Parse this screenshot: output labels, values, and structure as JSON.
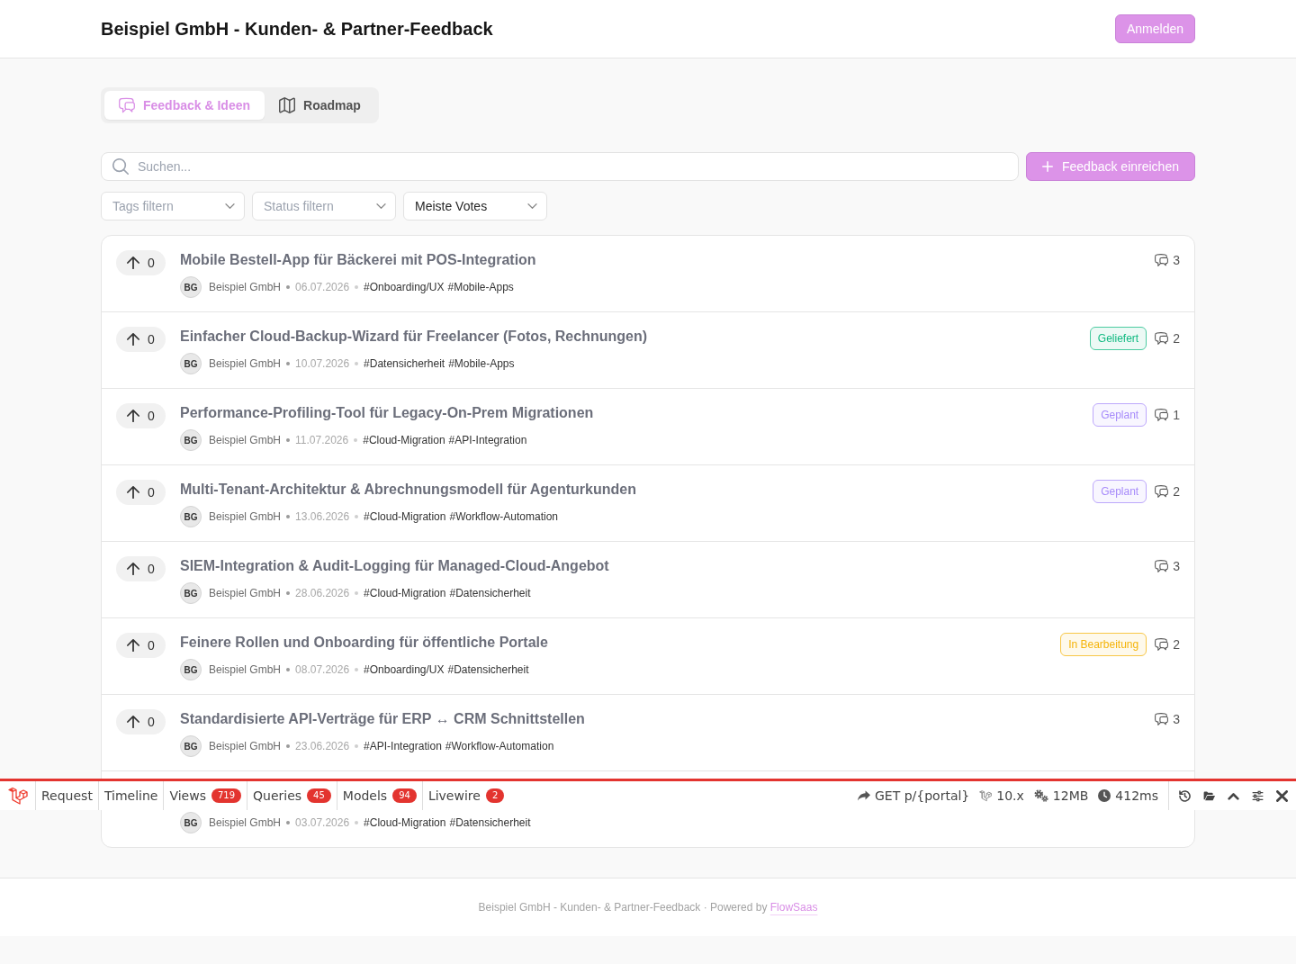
{
  "header": {
    "title": "Beispiel GmbH - Kunden- & Partner-Feedback",
    "login_button": "Anmelden"
  },
  "tabs": [
    {
      "label": "Feedback & Ideen",
      "selected": true
    },
    {
      "label": "Roadmap",
      "selected": false
    }
  ],
  "search": {
    "placeholder": "Suchen..."
  },
  "submit_button": "Feedback einreichen",
  "filters": [
    {
      "placeholder": "Tags filtern"
    },
    {
      "placeholder": "Status filtern"
    },
    {
      "value": "Meiste Votes"
    }
  ],
  "feedback_items": [
    {
      "votes": "0",
      "title": "Mobile Bestell-App für Bäckerei mit POS-Integration",
      "avatar": "BG",
      "author": "Beispiel GmbH",
      "date": "06.07.2026",
      "tags": [
        "#Onboarding/UX",
        "#Mobile-Apps"
      ],
      "comments": "3"
    },
    {
      "votes": "0",
      "title": "Einfacher Cloud-Backup-Wizard für Freelancer (Fotos, Rechnungen)",
      "avatar": "BG",
      "author": "Beispiel GmbH",
      "date": "10.07.2026",
      "tags": [
        "#Datensicherheit",
        "#Mobile-Apps"
      ],
      "status": {
        "label": "Geliefert",
        "color": "#10b981"
      },
      "comments": "2"
    },
    {
      "votes": "0",
      "title": "Performance-Profiling-Tool für Legacy-On-Prem Migrationen",
      "avatar": "BG",
      "author": "Beispiel GmbH",
      "date": "11.07.2026",
      "tags": [
        "#Cloud-Migration",
        "#API-Integration"
      ],
      "status": {
        "label": "Geplant",
        "color": "#a78bfa"
      },
      "comments": "1"
    },
    {
      "votes": "0",
      "title": "Multi-Tenant-Architektur & Abrechnungsmodell für Agenturkunden",
      "avatar": "BG",
      "author": "Beispiel GmbH",
      "date": "13.06.2026",
      "tags": [
        "#Cloud-Migration",
        "#Workflow-Automation"
      ],
      "status": {
        "label": "Geplant",
        "color": "#a78bfa"
      },
      "comments": "2"
    },
    {
      "votes": "0",
      "title": "SIEM-Integration & Audit-Logging für Managed-Cloud-Angebot",
      "avatar": "BG",
      "author": "Beispiel GmbH",
      "date": "28.06.2026",
      "tags": [
        "#Cloud-Migration",
        "#Datensicherheit"
      ],
      "comments": "3"
    },
    {
      "votes": "0",
      "title": "Feinere Rollen und Onboarding für öffentliche Portale",
      "avatar": "BG",
      "author": "Beispiel GmbH",
      "date": "08.07.2026",
      "tags": [
        "#Onboarding/UX",
        "#Datensicherheit"
      ],
      "status": {
        "label": "In Bearbeitung",
        "color": "#f5b40a"
      },
      "comments": "2"
    },
    {
      "votes": "0",
      "title": "Standardisierte API-Verträge für ERP ↔ CRM Schnittstellen",
      "avatar": "BG",
      "author": "Beispiel GmbH",
      "date": "23.06.2026",
      "tags": [
        "#API-Integration",
        "#Workflow-Automation"
      ],
      "comments": "3"
    },
    {
      "avatar": "BG",
      "author": "Beispiel GmbH",
      "date": "03.07.2026",
      "tags": [
        "#Cloud-Migration",
        "#Datensicherheit"
      ]
    }
  ],
  "footer": {
    "text": "Beispiel GmbH - Kunden- & Partner-Feedback · Powered by",
    "link": "FlowSaas"
  },
  "debug_bar": {
    "tabs": [
      {
        "label": "Request"
      },
      {
        "label": "Timeline"
      },
      {
        "label": "Views",
        "count": "719"
      },
      {
        "label": "Queries",
        "count": "45"
      },
      {
        "label": "Models",
        "count": "94"
      },
      {
        "label": "Livewire",
        "count": "2"
      }
    ],
    "info": [
      {
        "kind": "route",
        "text": "GET p/{portal}"
      },
      {
        "kind": "version",
        "text": "10.x"
      },
      {
        "kind": "memory",
        "text": "12MB"
      },
      {
        "kind": "time",
        "text": "412ms"
      }
    ]
  }
}
